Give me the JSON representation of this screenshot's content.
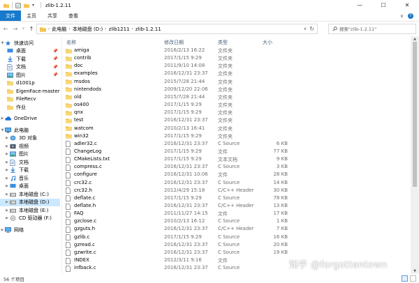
{
  "window": {
    "title": "zlib-1.2.11",
    "minimize_glyph": "—",
    "maximize_glyph": "☐",
    "close_glyph": "✕"
  },
  "ribbon": {
    "tabs": [
      {
        "label": "文件",
        "active": true
      },
      {
        "label": "主页"
      },
      {
        "label": "共享"
      },
      {
        "label": "查看"
      }
    ],
    "expand_glyph": "∨",
    "help_glyph": "?"
  },
  "nav": {
    "back_glyph": "←",
    "forward_glyph": "→",
    "recent_glyph": "∨",
    "up_glyph": "↑",
    "breadcrumbs": [
      "此电脑",
      "本地磁盘 (D:)",
      "zlib1211",
      "zlib-1.2.11"
    ],
    "crumb_separator": "›",
    "dropdown_glyph": "∨",
    "refresh_glyph": "↻",
    "search_placeholder": "搜索\"zlib-1.2.11\""
  },
  "sidebar": {
    "quick_access": "快速访问",
    "quick_items": [
      {
        "label": "桌面",
        "icon": "desktop-icon",
        "pinned": true
      },
      {
        "label": "下载",
        "icon": "download-icon",
        "pinned": true
      },
      {
        "label": "文档",
        "icon": "documents-icon",
        "pinned": true
      },
      {
        "label": "图片",
        "icon": "pictures-icon",
        "pinned": true
      },
      {
        "label": "d1001p",
        "icon": "folder-icon"
      },
      {
        "label": "EigenFace-master",
        "icon": "folder-icon"
      },
      {
        "label": "FileRecv",
        "icon": "folder-icon"
      },
      {
        "label": "作业",
        "icon": "folder-icon"
      }
    ],
    "onedrive": "OneDrive",
    "this_pc": "此电脑",
    "pc_items": [
      {
        "label": "3D 对象",
        "icon": "3d-objects-icon"
      },
      {
        "label": "视频",
        "icon": "videos-icon"
      },
      {
        "label": "图片",
        "icon": "pictures-icon"
      },
      {
        "label": "文档",
        "icon": "documents-icon"
      },
      {
        "label": "下载",
        "icon": "download-icon"
      },
      {
        "label": "音乐",
        "icon": "music-icon"
      },
      {
        "label": "桌面",
        "icon": "desktop-icon"
      },
      {
        "label": "本地磁盘 (C:)",
        "icon": "drive-icon"
      },
      {
        "label": "本地磁盘 (D:)",
        "icon": "drive-icon",
        "selected": true
      },
      {
        "label": "本地磁盘 (E:)",
        "icon": "drive-icon"
      },
      {
        "label": "CD 驱动器 (F:)",
        "icon": "cd-drive-icon"
      }
    ],
    "network": "网络"
  },
  "columns": {
    "name": "名称",
    "date": "修改日期",
    "type": "类型",
    "size": "大小"
  },
  "files": [
    {
      "name": "amiga",
      "date": "2016/2/13 16:22",
      "type": "文件夹",
      "size": "",
      "kind": "folder"
    },
    {
      "name": "contrib",
      "date": "2017/1/15 9:29",
      "type": "文件夹",
      "size": "",
      "kind": "folder"
    },
    {
      "name": "doc",
      "date": "2011/9/10 14:08",
      "type": "文件夹",
      "size": "",
      "kind": "folder"
    },
    {
      "name": "examples",
      "date": "2016/12/31 23:37",
      "type": "文件夹",
      "size": "",
      "kind": "folder"
    },
    {
      "name": "msdos",
      "date": "2015/7/28 21:44",
      "type": "文件夹",
      "size": "",
      "kind": "folder"
    },
    {
      "name": "nintendods",
      "date": "2009/12/20 22:06",
      "type": "文件夹",
      "size": "",
      "kind": "folder"
    },
    {
      "name": "old",
      "date": "2015/7/28 21:44",
      "type": "文件夹",
      "size": "",
      "kind": "folder"
    },
    {
      "name": "os400",
      "date": "2017/1/15 9:29",
      "type": "文件夹",
      "size": "",
      "kind": "folder"
    },
    {
      "name": "qnx",
      "date": "2017/1/15 9:29",
      "type": "文件夹",
      "size": "",
      "kind": "folder"
    },
    {
      "name": "test",
      "date": "2016/12/31 23:37",
      "type": "文件夹",
      "size": "",
      "kind": "folder"
    },
    {
      "name": "watcom",
      "date": "2010/2/13 16:41",
      "type": "文件夹",
      "size": "",
      "kind": "folder"
    },
    {
      "name": "win32",
      "date": "2017/1/15 9:29",
      "type": "文件夹",
      "size": "",
      "kind": "folder"
    },
    {
      "name": "adler32.c",
      "date": "2016/12/31 23:37",
      "type": "C Source",
      "size": "6 KB",
      "kind": "file"
    },
    {
      "name": "ChangeLog",
      "date": "2017/1/15 9:29",
      "type": "文件",
      "size": "77 KB",
      "kind": "file"
    },
    {
      "name": "CMakeLists.txt",
      "date": "2017/1/15 9:29",
      "type": "文本文档",
      "size": "9 KB",
      "kind": "file"
    },
    {
      "name": "compress.c",
      "date": "2016/12/31 23:37",
      "type": "C Source",
      "size": "3 KB",
      "kind": "file"
    },
    {
      "name": "configure",
      "date": "2016/12/31 10:06",
      "type": "文件",
      "size": "28 KB",
      "kind": "file"
    },
    {
      "name": "crc32.c",
      "date": "2016/12/31 23:37",
      "type": "C Source",
      "size": "14 KB",
      "kind": "file"
    },
    {
      "name": "crc32.h",
      "date": "2012/4/29 15:18",
      "type": "C/C++ Header",
      "size": "30 KB",
      "kind": "file"
    },
    {
      "name": "deflate.c",
      "date": "2017/1/15 9:29",
      "type": "C Source",
      "size": "78 KB",
      "kind": "file"
    },
    {
      "name": "deflate.h",
      "date": "2016/12/31 23:37",
      "type": "C/C++ Header",
      "size": "13 KB",
      "kind": "file"
    },
    {
      "name": "FAQ",
      "date": "2011/11/27 14:15",
      "type": "文件",
      "size": "17 KB",
      "kind": "file"
    },
    {
      "name": "gzclose.c",
      "date": "2010/2/13 16:12",
      "type": "C Source",
      "size": "1 KB",
      "kind": "file"
    },
    {
      "name": "gzguts.h",
      "date": "2016/12/31 23:37",
      "type": "C/C++ Header",
      "size": "7 KB",
      "kind": "file"
    },
    {
      "name": "gzlib.c",
      "date": "2017/1/15 9:29",
      "type": "C Source",
      "size": "16 KB",
      "kind": "file"
    },
    {
      "name": "gzread.c",
      "date": "2016/12/31 23:37",
      "type": "C Source",
      "size": "20 KB",
      "kind": "file"
    },
    {
      "name": "gzwrite.c",
      "date": "2016/12/31 23:37",
      "type": "C Source",
      "size": "19 KB",
      "kind": "file"
    },
    {
      "name": "INDEX",
      "date": "2012/3/11 9:16",
      "type": "文件",
      "size": "",
      "kind": "file"
    },
    {
      "name": "infback.c",
      "date": "2016/12/31 23:37",
      "type": "C Source",
      "size": "",
      "kind": "file"
    }
  ],
  "status": {
    "item_count": "56 个项目"
  },
  "watermark": "知乎 @forgottentown",
  "colors": {
    "accent": "#1979ca",
    "folder": "#f3c44f",
    "selected_row": "#cce8ff",
    "column_header": "#4c607a"
  }
}
